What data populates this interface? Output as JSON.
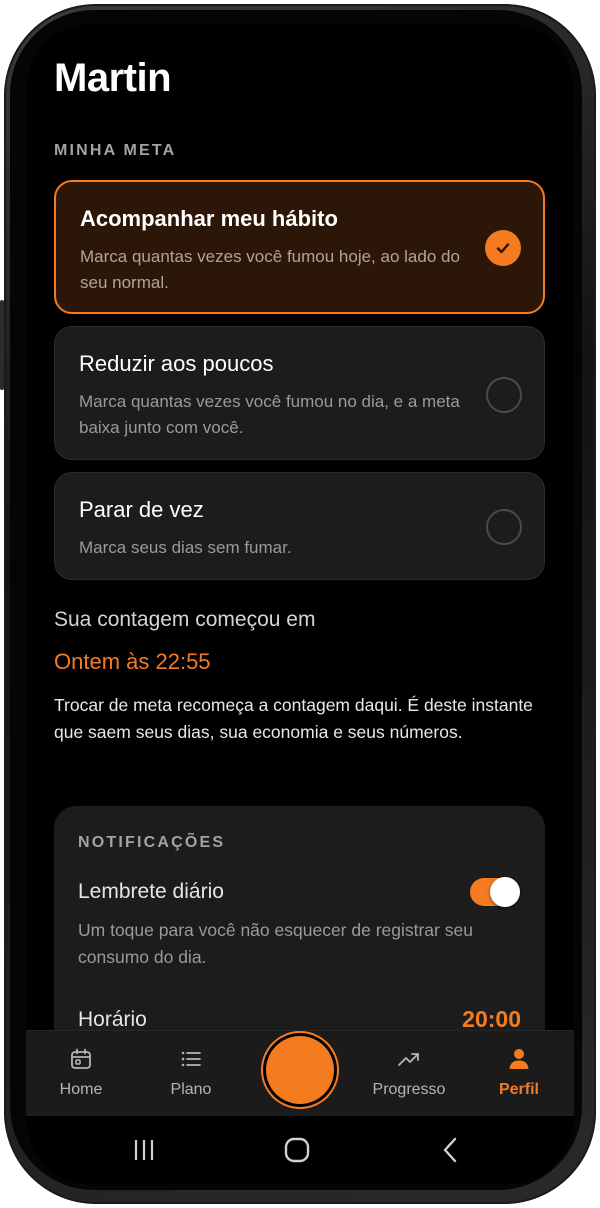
{
  "profile": {
    "name": "Martin"
  },
  "goal_section": {
    "label": "MINHA META",
    "options": [
      {
        "title": "Acompanhar meu hábito",
        "description": "Marca quantas vezes você fumou hoje, ao lado do seu normal.",
        "selected": true
      },
      {
        "title": "Reduzir aos poucos",
        "description": "Marca quantas vezes você fumou no dia, e a meta baixa junto com você.",
        "selected": false
      },
      {
        "title": "Parar de vez",
        "description": "Marca seus dias sem fumar.",
        "selected": false
      }
    ]
  },
  "count_start": {
    "label": "Sua contagem começou em",
    "value": "Ontem às 22:55",
    "note": "Trocar de meta recomeça a contagem daqui. É deste instante que saem seus dias, sua economia e seus números."
  },
  "notifications": {
    "label": "NOTIFICAÇÕES",
    "reminder_title": "Lembrete diário",
    "reminder_enabled": true,
    "reminder_description": "Um toque para você não esquecer de registrar seu consumo do dia.",
    "time_label": "Horário",
    "time_value": "20:00"
  },
  "tabbar": {
    "tabs": [
      {
        "label": "Home",
        "icon": "calendar-icon",
        "active": false
      },
      {
        "label": "Plano",
        "icon": "list-icon",
        "active": false
      },
      {
        "label": "Progresso",
        "icon": "trending-up-icon",
        "active": false
      },
      {
        "label": "Perfil",
        "icon": "person-icon",
        "active": true
      }
    ],
    "center_action_icon": "record-circle-icon"
  },
  "system_nav": {
    "icons": [
      "recents-icon",
      "home-icon",
      "back-icon"
    ]
  },
  "colors": {
    "accent": "#f47b20",
    "background": "#000000",
    "card": "#1c1c1c",
    "selected_card": "#2c1607"
  }
}
